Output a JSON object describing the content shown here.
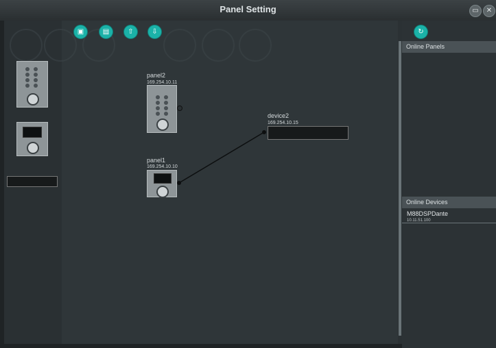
{
  "window": {
    "title": "Panel Setting",
    "minimize_icon": "minimize-icon",
    "close_icon": "close-icon"
  },
  "toolbar": {
    "save_icon": "save-icon",
    "open_icon": "folder-open-icon",
    "upload_icon": "upload-icon",
    "download_icon": "download-icon"
  },
  "right_panel": {
    "refresh_icon": "refresh-icon",
    "online_panels_label": "Online Panels",
    "online_devices_label": "Online Devices",
    "devices": [
      {
        "name": "M88DSPDante",
        "ip": "10.11.51.100"
      }
    ]
  },
  "canvas": {
    "nodes": [
      {
        "name": "panel2",
        "ip": "169.254.10.11"
      },
      {
        "name": "panel1",
        "ip": "169.254.10.10"
      },
      {
        "name": "device2",
        "ip": "169.254.10.15"
      }
    ]
  }
}
